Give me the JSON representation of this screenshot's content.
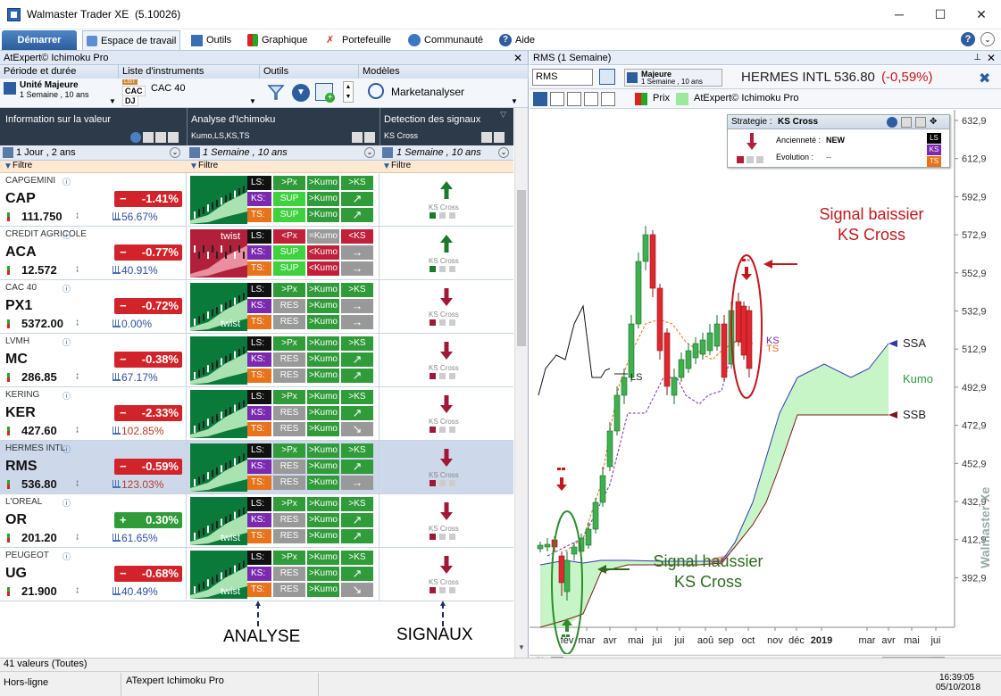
{
  "window": {
    "title": "Walmaster Trader XE",
    "version": "(5.10026)",
    "minimize": "─",
    "maximize": "☐",
    "close": "✕"
  },
  "menu": {
    "start": "Démarrer",
    "items": [
      {
        "label": "Espace de travail",
        "icon": "workspace-icon"
      },
      {
        "label": "Outils",
        "icon": "tools-icon"
      },
      {
        "label": "Graphique",
        "icon": "graph-icon"
      },
      {
        "label": "Portefeuille",
        "icon": "portfolio-icon"
      },
      {
        "label": "Communauté",
        "icon": "globe-icon"
      },
      {
        "label": "Aide",
        "icon": "help-icon"
      }
    ]
  },
  "left_panel": {
    "title": "AtExpert© Ichimoku Pro",
    "groups": {
      "period": {
        "label": "Période et durée",
        "unit": "Unité Majeure",
        "value": "1 Semaine , 10 ans"
      },
      "list": {
        "label": "Liste d'instruments",
        "value": "CAC 40",
        "items": [
          "CAC",
          "DJ"
        ],
        "tag": "LIST"
      },
      "tools": {
        "label": "Outils"
      },
      "models": {
        "label": "Modèles",
        "value": "Marketanalyser"
      }
    },
    "columns": {
      "info": {
        "title": "Information sur la valeur",
        "period": "1 Jour , 2 ans",
        "filter": "Filtre"
      },
      "analysis": {
        "title": "Analyse d'Ichimoku",
        "sub": "Kumo,LS,KS,TS",
        "period": "1 Semaine , 10 ans",
        "filter": "Filtre"
      },
      "signals": {
        "title": "Detection des signaux",
        "sub": "KS Cross",
        "period": "1 Semaine , 10 ans",
        "filter": "Filtre"
      }
    },
    "rows": [
      {
        "name": "CAPGEMINI",
        "code": "CAP",
        "price": "111.750",
        "change": "-1.41%",
        "sign": "−",
        "dir": "neg",
        "perf": "56.67%",
        "perf_color": "blue",
        "thumb": "green",
        "twist": "",
        "ls": [
          ">Px",
          "SUP",
          "SUP"
        ],
        "cols": [
          ">Kumo",
          ">Kumo",
          ">Kumo"
        ],
        "arrows": [
          ">KS",
          "↗",
          "↗"
        ],
        "signal": "up"
      },
      {
        "name": "CREDIT AGRICOLE",
        "code": "ACA",
        "price": "12.572",
        "change": "-0.77%",
        "sign": "−",
        "dir": "neg",
        "perf": "40.91%",
        "perf_color": "blue",
        "thumb": "red",
        "twist": "twist",
        "ls": [
          "<Px",
          "SUP",
          "SUP"
        ],
        "cols": [
          "=Kumo",
          "<Kumo",
          "<Kumo"
        ],
        "arrows": [
          "<KS",
          "→",
          "→"
        ],
        "signal": "up"
      },
      {
        "name": "CAC 40",
        "code": "PX1",
        "price": "5372.00",
        "change": "-0.72%",
        "sign": "−",
        "dir": "neg",
        "perf": "0.00%",
        "perf_color": "blue",
        "thumb": "green",
        "twist": "twist",
        "ls": [
          ">Px",
          "RES",
          "RES"
        ],
        "cols": [
          ">Kumo",
          ">Kumo",
          ">Kumo"
        ],
        "arrows": [
          ">KS",
          "→",
          "→"
        ],
        "signal": "down"
      },
      {
        "name": "LVMH",
        "code": "MC",
        "price": "286.85",
        "change": "-0.38%",
        "sign": "−",
        "dir": "neg",
        "perf": "67.17%",
        "perf_color": "blue",
        "thumb": "green",
        "twist": "",
        "ls": [
          ">Px",
          "RES",
          "RES"
        ],
        "cols": [
          ">Kumo",
          ">Kumo",
          ">Kumo"
        ],
        "arrows": [
          ">KS",
          "↗",
          "↗"
        ],
        "signal": "down"
      },
      {
        "name": "KERING",
        "code": "KER",
        "price": "427.60",
        "change": "-2.33%",
        "sign": "−",
        "dir": "neg",
        "perf": "102.85%",
        "perf_color": "red",
        "thumb": "green",
        "twist": "",
        "ls": [
          ">Px",
          "RES",
          "RES"
        ],
        "cols": [
          ">Kumo",
          ">Kumo",
          ">Kumo"
        ],
        "arrows": [
          ">KS",
          "↗",
          "↘"
        ],
        "signal": "down"
      },
      {
        "name": "HERMES INTL",
        "code": "RMS",
        "price": "536.80",
        "change": "-0.59%",
        "sign": "−",
        "dir": "neg",
        "perf": "123.03%",
        "perf_color": "red",
        "thumb": "green",
        "twist": "",
        "ls": [
          ">Px",
          "RES",
          "RES"
        ],
        "cols": [
          ">Kumo",
          ">Kumo",
          ">Kumo"
        ],
        "arrows": [
          ">KS",
          "↗",
          "→"
        ],
        "signal": "down"
      },
      {
        "name": "L'OREAL",
        "code": "OR",
        "price": "201.20",
        "change": "0.30%",
        "sign": "+",
        "dir": "pos",
        "perf": "61.65%",
        "perf_color": "blue",
        "thumb": "green",
        "twist": "twist",
        "ls": [
          ">Px",
          "RES",
          "RES"
        ],
        "cols": [
          ">Kumo",
          ">Kumo",
          ">Kumo"
        ],
        "arrows": [
          ">KS",
          "↗",
          "↗"
        ],
        "signal": "down"
      },
      {
        "name": "PEUGEOT",
        "code": "UG",
        "price": "21.900",
        "change": "-0.68%",
        "sign": "−",
        "dir": "neg",
        "perf": "40.49%",
        "perf_color": "blue",
        "thumb": "green",
        "twist": "twist",
        "ls": [
          ">Px",
          "RES",
          "RES"
        ],
        "cols": [
          ">Kumo",
          ">Kumo",
          ">Kumo"
        ],
        "arrows": [
          ">KS",
          "↗",
          "↘"
        ],
        "signal": "down"
      }
    ],
    "row_labels": [
      "LS:",
      "KS:",
      "TS:"
    ],
    "signal_label": "KS Cross",
    "annotations": {
      "analyse": "ANALYSE",
      "signaux": "SIGNAUX"
    },
    "footer": "41 valeurs (Toutes)"
  },
  "right_panel": {
    "title": "RMS (1 Semaine)",
    "symbol": "RMS",
    "unit": "Majeure",
    "unit_value": "1 Semaine , 10 ans",
    "instrument": "HERMES INTL",
    "price": "536.80",
    "change": "(-0,59%)",
    "legend_prix": "Prix",
    "legend_ichimoku": "AtExpert© Ichimoku Pro",
    "strategy": {
      "title": "Strategie :",
      "name": "KS Cross",
      "age_label": "Ancienneté :",
      "age": "NEW",
      "evo_label": "Evolution :",
      "evo": "--",
      "tags": [
        "LS",
        "KS",
        "TS"
      ]
    },
    "axis_y": [
      "632,9",
      "612,9",
      "592,9",
      "572,9",
      "552,9",
      "532,9",
      "512,9",
      "492,9",
      "472,9",
      "452,9",
      "432,9",
      "412,9",
      "392,9"
    ],
    "axis_x": [
      "fév",
      "mar",
      "avr",
      "mai",
      "jui",
      "jui",
      "aoû",
      "sep",
      "oct",
      "nov",
      "déc",
      "2019",
      "mar",
      "avr",
      "mai",
      "jui"
    ],
    "labels": {
      "ssa": "SSA",
      "ssb": "SSB",
      "kumo": "Kumo",
      "ks": "KS",
      "ts": "TS",
      "ls": "LS"
    },
    "sell_signal": [
      "Signal baissier",
      "KS Cross"
    ],
    "buy_signal": [
      "Signal haussier",
      "KS Cross"
    ],
    "watermark": "Walmaster Xe"
  },
  "status": {
    "state": "Hors-ligne",
    "module": "ATexpert Ichimoku Pro",
    "time": "16:39:05",
    "date": "05/10/2018"
  },
  "colors": {
    "accent": "#2c5d9e",
    "neg": "#d2232a",
    "pos": "#2f9b39",
    "kumo": "#c8f5c8",
    "sell": "#c0181d",
    "buy": "#2e6b1e"
  }
}
